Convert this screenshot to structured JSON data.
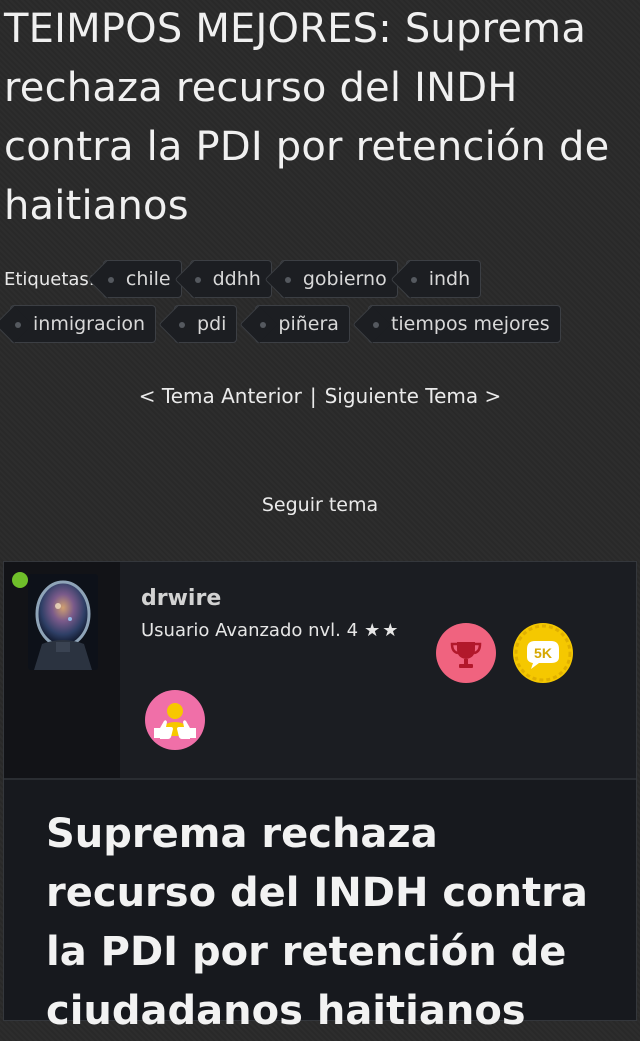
{
  "topic": {
    "title": "TEIMPOS MEJORES: Suprema rechaza recurso del INDH contra la PDI por retención de haitianos"
  },
  "tags": {
    "label": "Etiquetas:",
    "items": [
      "chile",
      "ddhh",
      "gobierno",
      "indh",
      "inmigracion",
      "pdi",
      "piñera",
      "tiempos mejores"
    ]
  },
  "navigation": {
    "previous": "< Tema Anterior",
    "separator": "|",
    "next": "Siguiente Tema >"
  },
  "follow": {
    "label": "Seguir tema"
  },
  "post": {
    "author": {
      "username": "drwire",
      "rank": "Usuario Avanzado nvl. 4",
      "stars": "★★",
      "online": true,
      "badges": [
        {
          "icon": "trophy-icon",
          "color": "#f0637f"
        },
        {
          "icon": "5k-icon",
          "text": "5K",
          "color": "#f5c800"
        },
        {
          "icon": "thumbs-up-user-icon",
          "color": "#f06fa8"
        }
      ]
    },
    "title": "Suprema rechaza recurso del INDH contra la PDI por retención de ciudadanos haitianos"
  }
}
